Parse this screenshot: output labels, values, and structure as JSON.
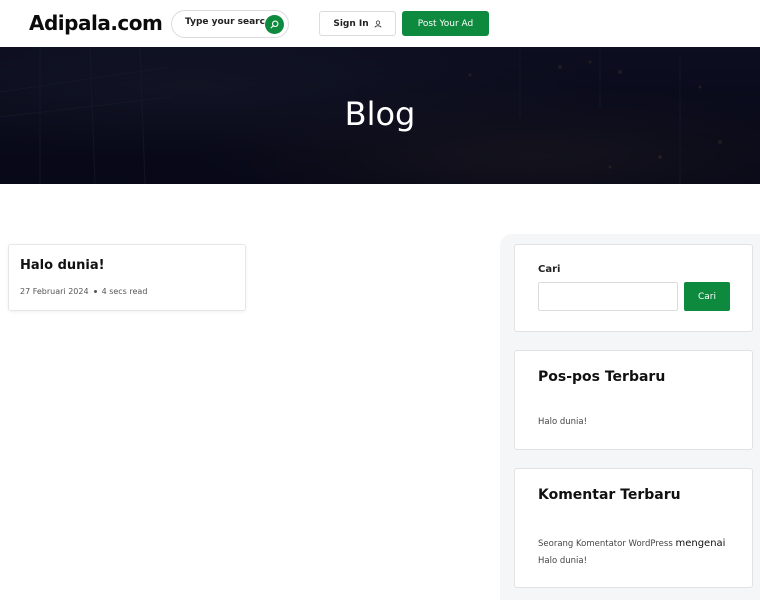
{
  "header": {
    "logo": "Adipala.com",
    "search_placeholder": "Type your search..",
    "signin_label": "Sign In",
    "post_ad_label": "Post Your Ad"
  },
  "hero": {
    "title": "Blog"
  },
  "posts": [
    {
      "title": "Halo dunia!",
      "date": "27 Februari 2024",
      "read_time": "4 secs read"
    }
  ],
  "sidebar": {
    "search_label": "Cari",
    "search_button": "Cari",
    "recent_title": "Pos-pos Terbaru",
    "recent_items": [
      "Halo dunia!"
    ],
    "comments_title": "Komentar Terbaru",
    "comment": {
      "author": "Seorang Komentator WordPress",
      "connector": "mengenai",
      "post": "Halo dunia!"
    }
  },
  "colors": {
    "accent": "#0e8a3e",
    "hero_overlay": "#08081e"
  }
}
